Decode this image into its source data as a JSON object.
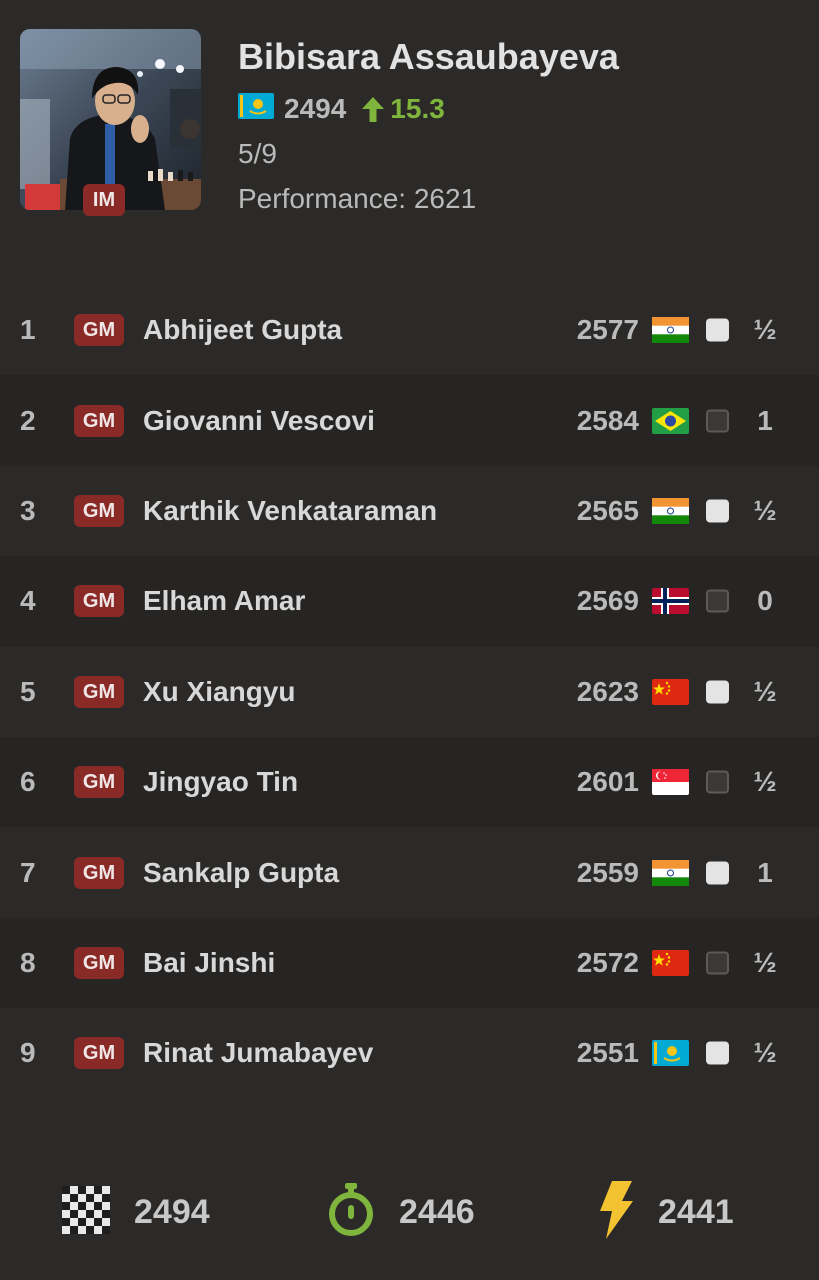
{
  "player": {
    "name": "Bibisara Assaubayeva",
    "title": "IM",
    "country_flag": "kazakhstan-flag-icon",
    "rating": "2494",
    "rating_change": "15.3",
    "score": "5/9",
    "performance": "Performance: 2621"
  },
  "games": [
    {
      "round": "1",
      "title": "GM",
      "name": "Abhijeet Gupta",
      "rating": "2577",
      "flag": "india-flag-icon",
      "color": "white",
      "result": "½"
    },
    {
      "round": "2",
      "title": "GM",
      "name": "Giovanni Vescovi",
      "rating": "2584",
      "flag": "brazil-flag-icon",
      "color": "black",
      "result": "1"
    },
    {
      "round": "3",
      "title": "GM",
      "name": "Karthik Venkataraman",
      "rating": "2565",
      "flag": "india-flag-icon",
      "color": "white",
      "result": "½"
    },
    {
      "round": "4",
      "title": "GM",
      "name": "Elham Amar",
      "rating": "2569",
      "flag": "norway-flag-icon",
      "color": "black",
      "result": "0"
    },
    {
      "round": "5",
      "title": "GM",
      "name": "Xu Xiangyu",
      "rating": "2623",
      "flag": "china-flag-icon",
      "color": "white",
      "result": "½"
    },
    {
      "round": "6",
      "title": "GM",
      "name": "Jingyao Tin",
      "rating": "2601",
      "flag": "singapore-flag-icon",
      "color": "black",
      "result": "½"
    },
    {
      "round": "7",
      "title": "GM",
      "name": "Sankalp Gupta",
      "rating": "2559",
      "flag": "india-flag-icon",
      "color": "white",
      "result": "1"
    },
    {
      "round": "8",
      "title": "GM",
      "name": "Bai Jinshi",
      "rating": "2572",
      "flag": "china-flag-icon",
      "color": "black",
      "result": "½"
    },
    {
      "round": "9",
      "title": "GM",
      "name": "Rinat Jumabayev",
      "rating": "2551",
      "flag": "kazakhstan-flag-icon",
      "color": "white",
      "result": "½"
    }
  ],
  "ratings": {
    "standard": {
      "icon": "checkered-board-icon",
      "value": "2494"
    },
    "rapid": {
      "icon": "stopwatch-icon",
      "value": "2446"
    },
    "blitz": {
      "icon": "lightning-icon",
      "value": "2441"
    }
  },
  "colors": {
    "background": "#2b2a28",
    "row_alt": "#262523",
    "title_badge": "#8a2a27",
    "gain": "#7fb53d",
    "rapid_icon": "#7fb53d",
    "blitz_icon": "#f2c230"
  }
}
